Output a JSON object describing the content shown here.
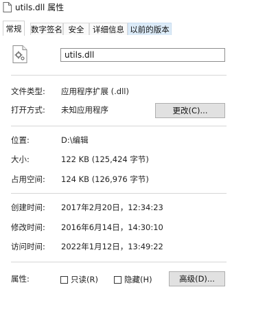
{
  "window": {
    "title": "utils.dll 属性"
  },
  "tabs": [
    {
      "label": "常规",
      "active": true
    },
    {
      "label": "数字签名"
    },
    {
      "label": "安全"
    },
    {
      "label": "详细信息"
    },
    {
      "label": "以前的版本",
      "highlighted": true
    }
  ],
  "general": {
    "file_name": "utils.dll",
    "icon": "dll-file-gear-icon",
    "rows": {
      "file_type": {
        "label": "文件类型:",
        "value": "应用程序扩展 (.dll)"
      },
      "opens_with": {
        "label": "打开方式:",
        "value": "未知应用程序",
        "button": "更改(C)..."
      },
      "location": {
        "label": "位置:",
        "value": "D:\\编辑"
      },
      "size": {
        "label": "大小:",
        "value": "122 KB (125,424 字节)"
      },
      "size_on_disk": {
        "label": "占用空间:",
        "value": "124 KB (126,976 字节)"
      },
      "created": {
        "label": "创建时间:",
        "value": "2017年2月20日，12:34:23"
      },
      "modified": {
        "label": "修改时间:",
        "value": "2016年6月14日，14:30:10"
      },
      "accessed": {
        "label": "访问时间:",
        "value": "2022年1月12日，13:49:22"
      }
    },
    "attributes": {
      "label": "属性:",
      "readonly": {
        "label": "只读(R)",
        "checked": false
      },
      "hidden": {
        "label": "隐藏(H)",
        "checked": false
      },
      "advanced_button": "高级(D)..."
    }
  }
}
